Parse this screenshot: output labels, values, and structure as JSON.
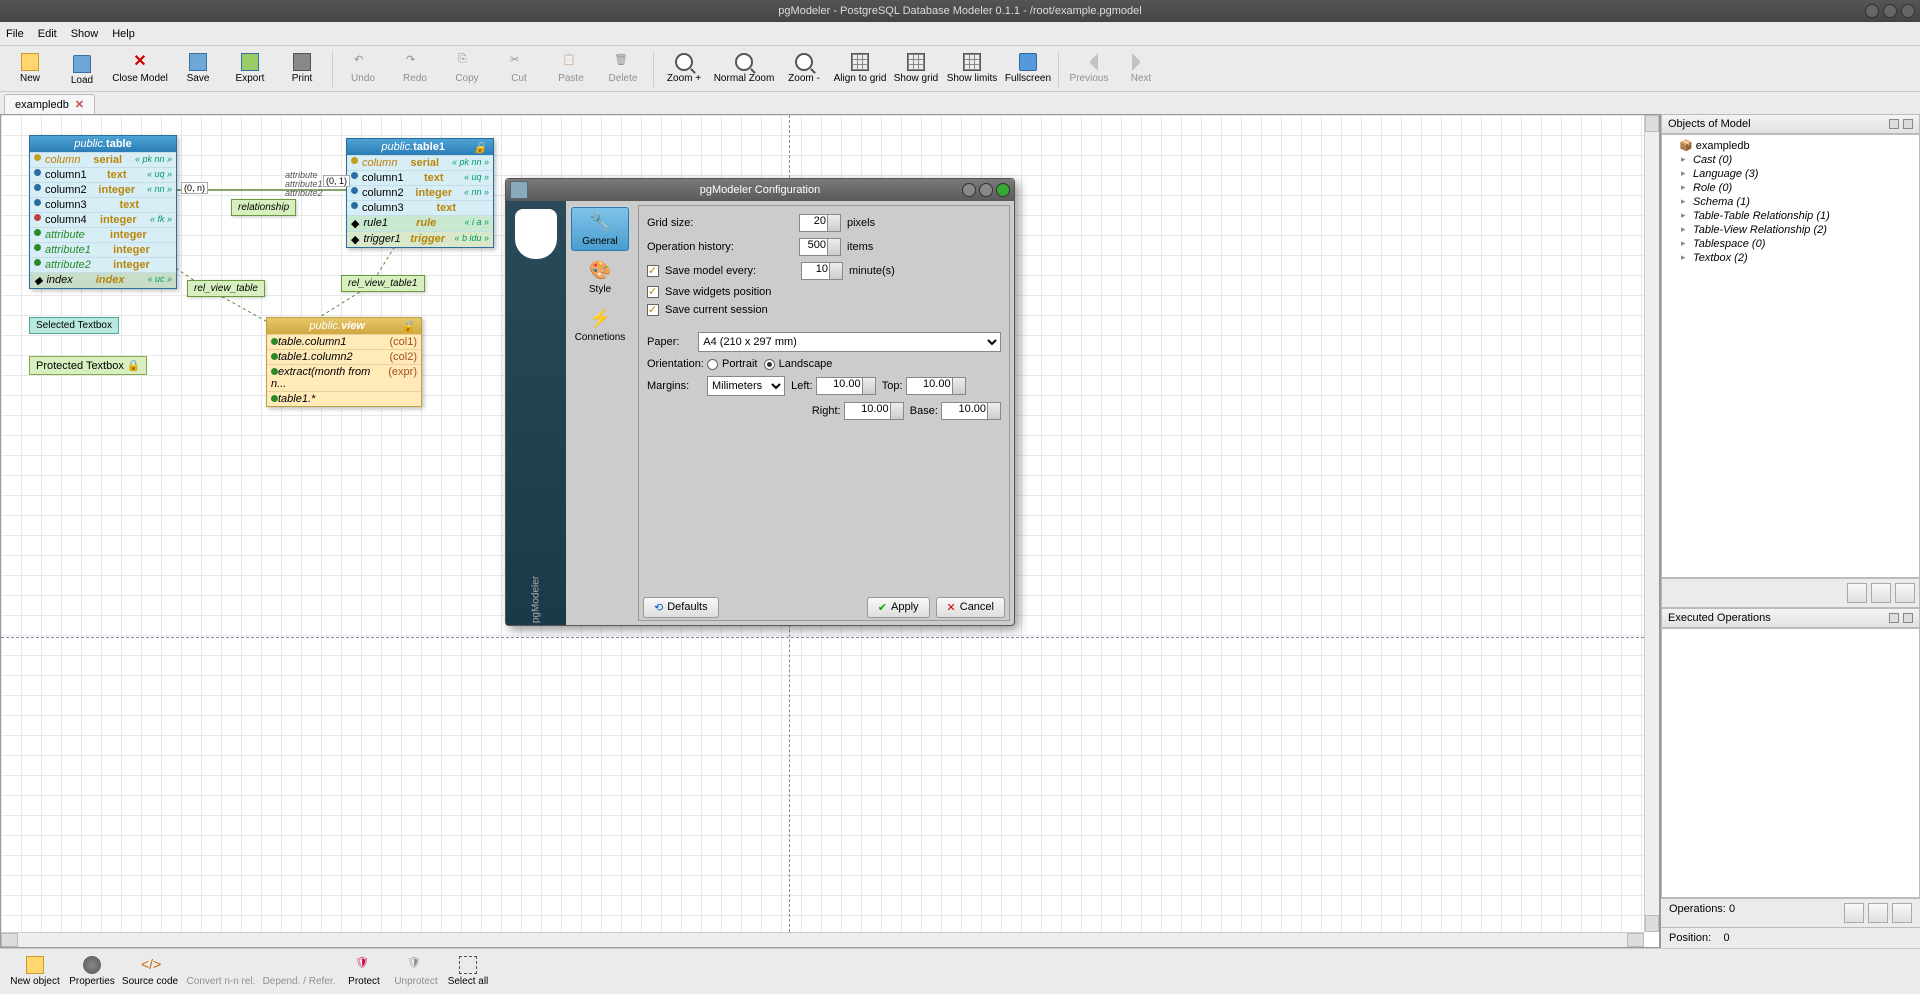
{
  "titlebar": "pgModeler - PostgreSQL Database Modeler 0.1.1 - /root/example.pgmodel",
  "menu": {
    "file": "File",
    "edit": "Edit",
    "show": "Show",
    "help": "Help"
  },
  "toolbar": {
    "new": "New",
    "load": "Load",
    "close": "Close Model",
    "save": "Save",
    "export": "Export",
    "print": "Print",
    "undo": "Undo",
    "redo": "Redo",
    "copy": "Copy",
    "cut": "Cut",
    "paste": "Paste",
    "delete": "Delete",
    "zoomIn": "Zoom +",
    "normalZoom": "Normal Zoom",
    "zoomOut": "Zoom -",
    "align": "Align to grid",
    "showGrid": "Show grid",
    "showLimits": "Show limits",
    "fullscreen": "Fullscreen",
    "prev": "Previous",
    "next": "Next"
  },
  "tab": {
    "name": "exampledb"
  },
  "canvas": {
    "table": {
      "header_schema": "public.",
      "header_name": "table",
      "rows": [
        {
          "n": "column",
          "t": "serial",
          "c": "« pk nn »",
          "k": "pk"
        },
        {
          "n": "column1",
          "t": "text",
          "c": "« uq »"
        },
        {
          "n": "column2",
          "t": "integer",
          "c": "« nn »"
        },
        {
          "n": "column3",
          "t": "text",
          "c": ""
        },
        {
          "n": "column4",
          "t": "integer",
          "c": "« fk »",
          "k": "fk"
        },
        {
          "n": "attribute",
          "t": "integer",
          "c": "",
          "k": "attr"
        },
        {
          "n": "attribute1",
          "t": "integer",
          "c": "",
          "k": "attr"
        },
        {
          "n": "attribute2",
          "t": "integer",
          "c": "",
          "k": "attr"
        }
      ],
      "idx": {
        "n": "index",
        "t": "index",
        "c": "« uc »"
      }
    },
    "table1": {
      "header_schema": "public.",
      "header_name": "table1",
      "rows": [
        {
          "n": "column",
          "t": "serial",
          "c": "« pk nn »",
          "k": "pk"
        },
        {
          "n": "column1",
          "t": "text",
          "c": "« uq »"
        },
        {
          "n": "column2",
          "t": "integer",
          "c": "« nn »"
        },
        {
          "n": "column3",
          "t": "text",
          "c": ""
        }
      ],
      "rule": {
        "n": "rule1",
        "t": "rule",
        "c": "« i a »"
      },
      "trig": {
        "n": "trigger1",
        "t": "trigger",
        "c": "« b idu »"
      }
    },
    "view": {
      "header_schema": "public.",
      "header_name": "view",
      "rows": [
        {
          "n": "table.column1",
          "c": "(col1)"
        },
        {
          "n": "table1.column2",
          "c": "(col2)"
        },
        {
          "n": "extract(month from n...",
          "c": "(expr)"
        },
        {
          "n": "table1.*",
          "c": ""
        }
      ]
    },
    "rel": "relationship",
    "relv": "rel_view_table",
    "relv1": "rel_view_table1",
    "attr": "attribute",
    "attr1": "attribute1",
    "attr2": "attribute2",
    "card1": "(0, n)",
    "card2": "(0, 1)",
    "seltext": "Selected Textbox",
    "prottext": "Protected Textbox"
  },
  "side": {
    "objects_h": "Objects of Model",
    "root": "exampledb",
    "items": [
      "Cast (0)",
      "Language (3)",
      "Role (0)",
      "Schema (1)",
      "Table-Table Relationship (1)",
      "Table-View Relationship (2)",
      "Tablespace (0)",
      "Textbox (2)"
    ],
    "ops_h": "Executed Operations",
    "ops": "Operations:",
    "ops_v": "0",
    "pos": "Position:",
    "pos_v": "0"
  },
  "bottom": {
    "newobj": "New object",
    "props": "Properties",
    "src": "Source code",
    "conv": "Convert n-n rel.",
    "dep": "Depend. / Refer.",
    "protect": "Protect",
    "unprotect": "Unprotect",
    "selall": "Select all"
  },
  "dialog": {
    "title": "pgModeler Configuration",
    "tabs": {
      "general": "General",
      "style": "Style",
      "conn": "Connetions"
    },
    "grid": "Grid size:",
    "grid_v": "20",
    "grid_u": "pixels",
    "hist": "Operation history:",
    "hist_v": "500",
    "hist_u": "items",
    "autosave": "Save model every:",
    "autosave_v": "10",
    "autosave_u": "minute(s)",
    "savewidg": "Save widgets position",
    "savesess": "Save current session",
    "paper": "Paper:",
    "paper_v": "A4 (210 x 297 mm)",
    "orient": "Orientation:",
    "portrait": "Portrait",
    "landscape": "Landscape",
    "margins": "Margins:",
    "marg_unit": "Milimeters",
    "left": "Left:",
    "left_v": "10.00",
    "top": "Top:",
    "top_v": "10.00",
    "right": "Right:",
    "right_v": "10.00",
    "base": "Base:",
    "base_v": "10.00",
    "defaults": "Defaults",
    "apply": "Apply",
    "cancel": "Cancel"
  }
}
